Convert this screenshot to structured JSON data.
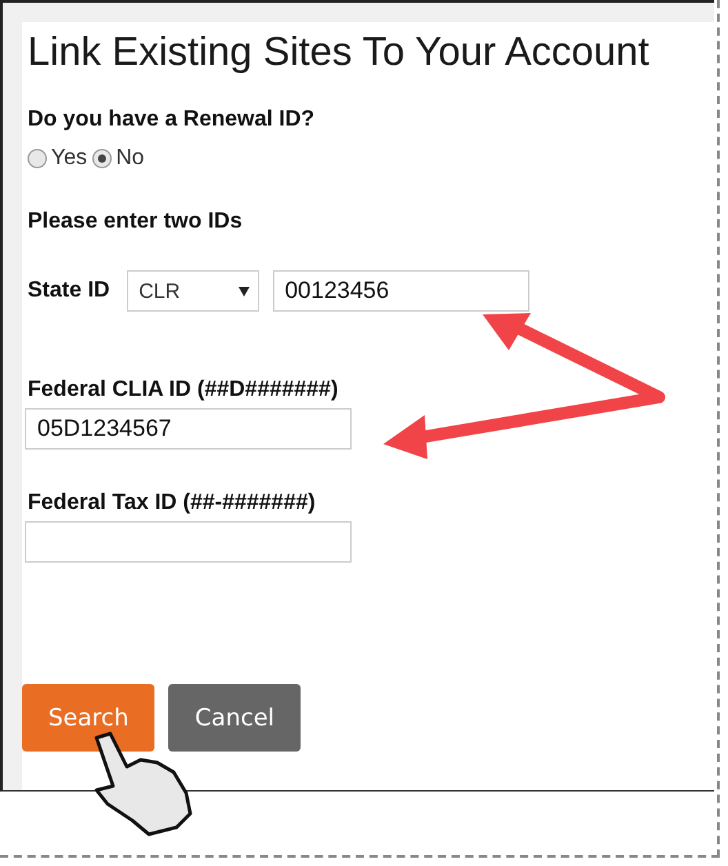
{
  "title": "Link Existing Sites To Your Account",
  "renewal": {
    "question": "Do you have a Renewal ID?",
    "options": [
      {
        "label": "Yes",
        "selected": false
      },
      {
        "label": "No",
        "selected": true
      }
    ]
  },
  "instruction": "Please enter two IDs",
  "state_id": {
    "label": "State ID",
    "select_value": "CLR",
    "value": "00123456"
  },
  "fields": [
    {
      "label": "Federal CLIA ID (##D#######)",
      "value": "05D1234567"
    },
    {
      "label": "Federal Tax ID (##-#######)"
    }
  ],
  "buttons": [
    {
      "label": "Search",
      "kind": "primary"
    },
    {
      "label": "Cancel",
      "kind": "secondary"
    }
  ]
}
